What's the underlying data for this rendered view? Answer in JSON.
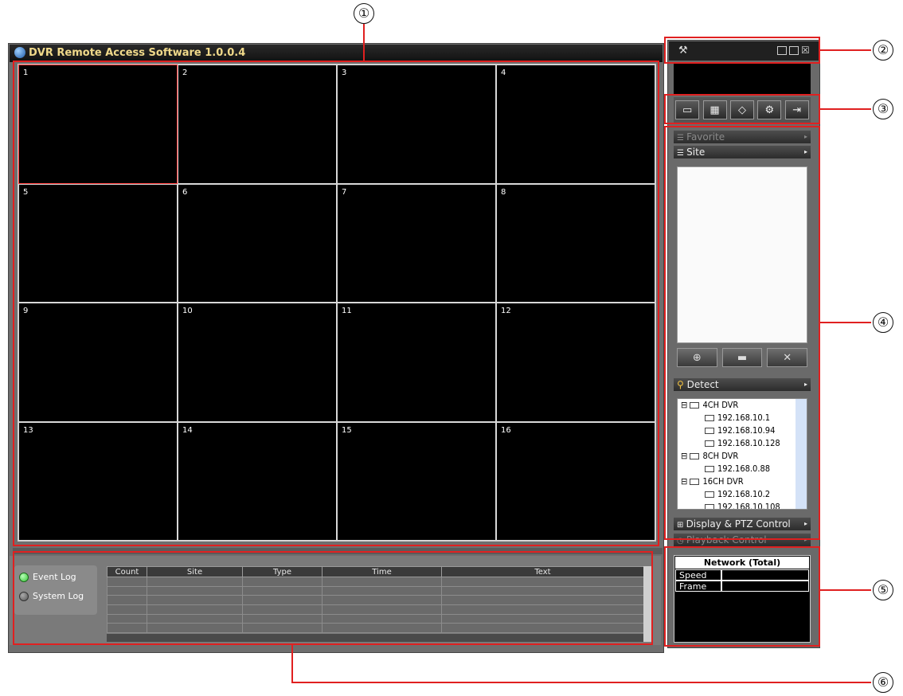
{
  "window": {
    "title": "DVR Remote Access Software  1.0.0.4"
  },
  "cells": [
    "1",
    "2",
    "3",
    "4",
    "5",
    "6",
    "7",
    "8",
    "9",
    "10",
    "11",
    "12",
    "13",
    "14",
    "15",
    "16"
  ],
  "side": {
    "toolbar_icons": [
      "camera-icon",
      "grid-icon",
      "eraser-icon",
      "settings-gears-icon",
      "connect-icon"
    ],
    "favorite_label": "Favorite",
    "site_label": "Site",
    "site_buttons": [
      "⊕",
      "▬",
      "✕"
    ],
    "detect_label": "Detect",
    "tree": [
      {
        "type": "group",
        "label": "4CH DVR"
      },
      {
        "type": "ip",
        "label": "192.168.10.1"
      },
      {
        "type": "ip",
        "label": "192.168.10.94"
      },
      {
        "type": "ip",
        "label": "192.168.10.128"
      },
      {
        "type": "group",
        "label": "8CH DVR"
      },
      {
        "type": "ip",
        "label": "192.168.0.88"
      },
      {
        "type": "group",
        "label": "16CH DVR"
      },
      {
        "type": "ip",
        "label": "192.168.10.2"
      },
      {
        "type": "ip",
        "label": "192.168.10.108"
      }
    ],
    "display_ptz_label": "Display & PTZ Control",
    "playback_label": "Playback Control"
  },
  "network": {
    "title": "Network (Total)",
    "speed_label": "Speed",
    "frame_label": "Frame"
  },
  "log": {
    "event_label": "Event Log",
    "system_label": "System Log",
    "columns": [
      "Count",
      "Site",
      "Type",
      "Time",
      "Text"
    ]
  },
  "callouts": [
    "①",
    "②",
    "③",
    "④",
    "⑤",
    "⑥"
  ],
  "colors": {
    "accent_red": "#e02020",
    "title_text": "#f0d98a",
    "event_active": "#35c435",
    "system_inactive": "#555555"
  }
}
